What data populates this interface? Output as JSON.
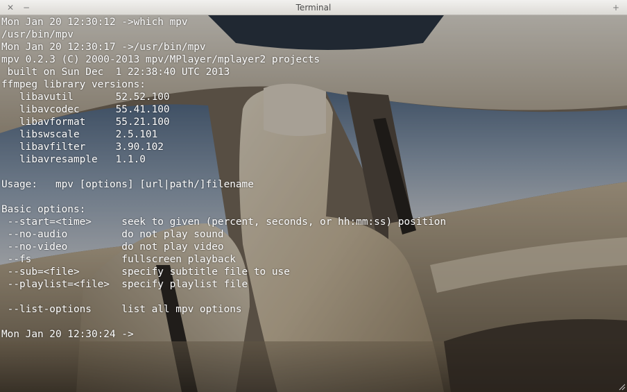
{
  "window": {
    "title": "Terminal",
    "close_icon": "✕",
    "minimize_icon": "−",
    "maximize_icon": "+"
  },
  "terminal": {
    "lines": [
      "Mon Jan 20 12:30:12 ->which mpv",
      "/usr/bin/mpv",
      "Mon Jan 20 12:30:17 ->/usr/bin/mpv",
      "mpv 0.2.3 (C) 2000-2013 mpv/MPlayer/mplayer2 projects",
      " built on Sun Dec  1 22:38:40 UTC 2013",
      "ffmpeg library versions:",
      "   libavutil       52.52.100",
      "   libavcodec      55.41.100",
      "   libavformat     55.21.100",
      "   libswscale      2.5.101",
      "   libavfilter     3.90.102",
      "   libavresample   1.1.0",
      "",
      "Usage:   mpv [options] [url|path/]filename",
      "",
      "Basic options:",
      " --start=<time>     seek to given (percent, seconds, or hh:mm:ss) position",
      " --no-audio         do not play sound",
      " --no-video         do not play video",
      " --fs               fullscreen playback",
      " --sub=<file>       specify subtitle file to use",
      " --playlist=<file>  specify playlist file",
      "",
      " --list-options     list all mpv options",
      "",
      "Mon Jan 20 12:30:24 ->"
    ]
  },
  "colors": {
    "text": "#ffffff",
    "titlebar": "#dcdad5"
  }
}
